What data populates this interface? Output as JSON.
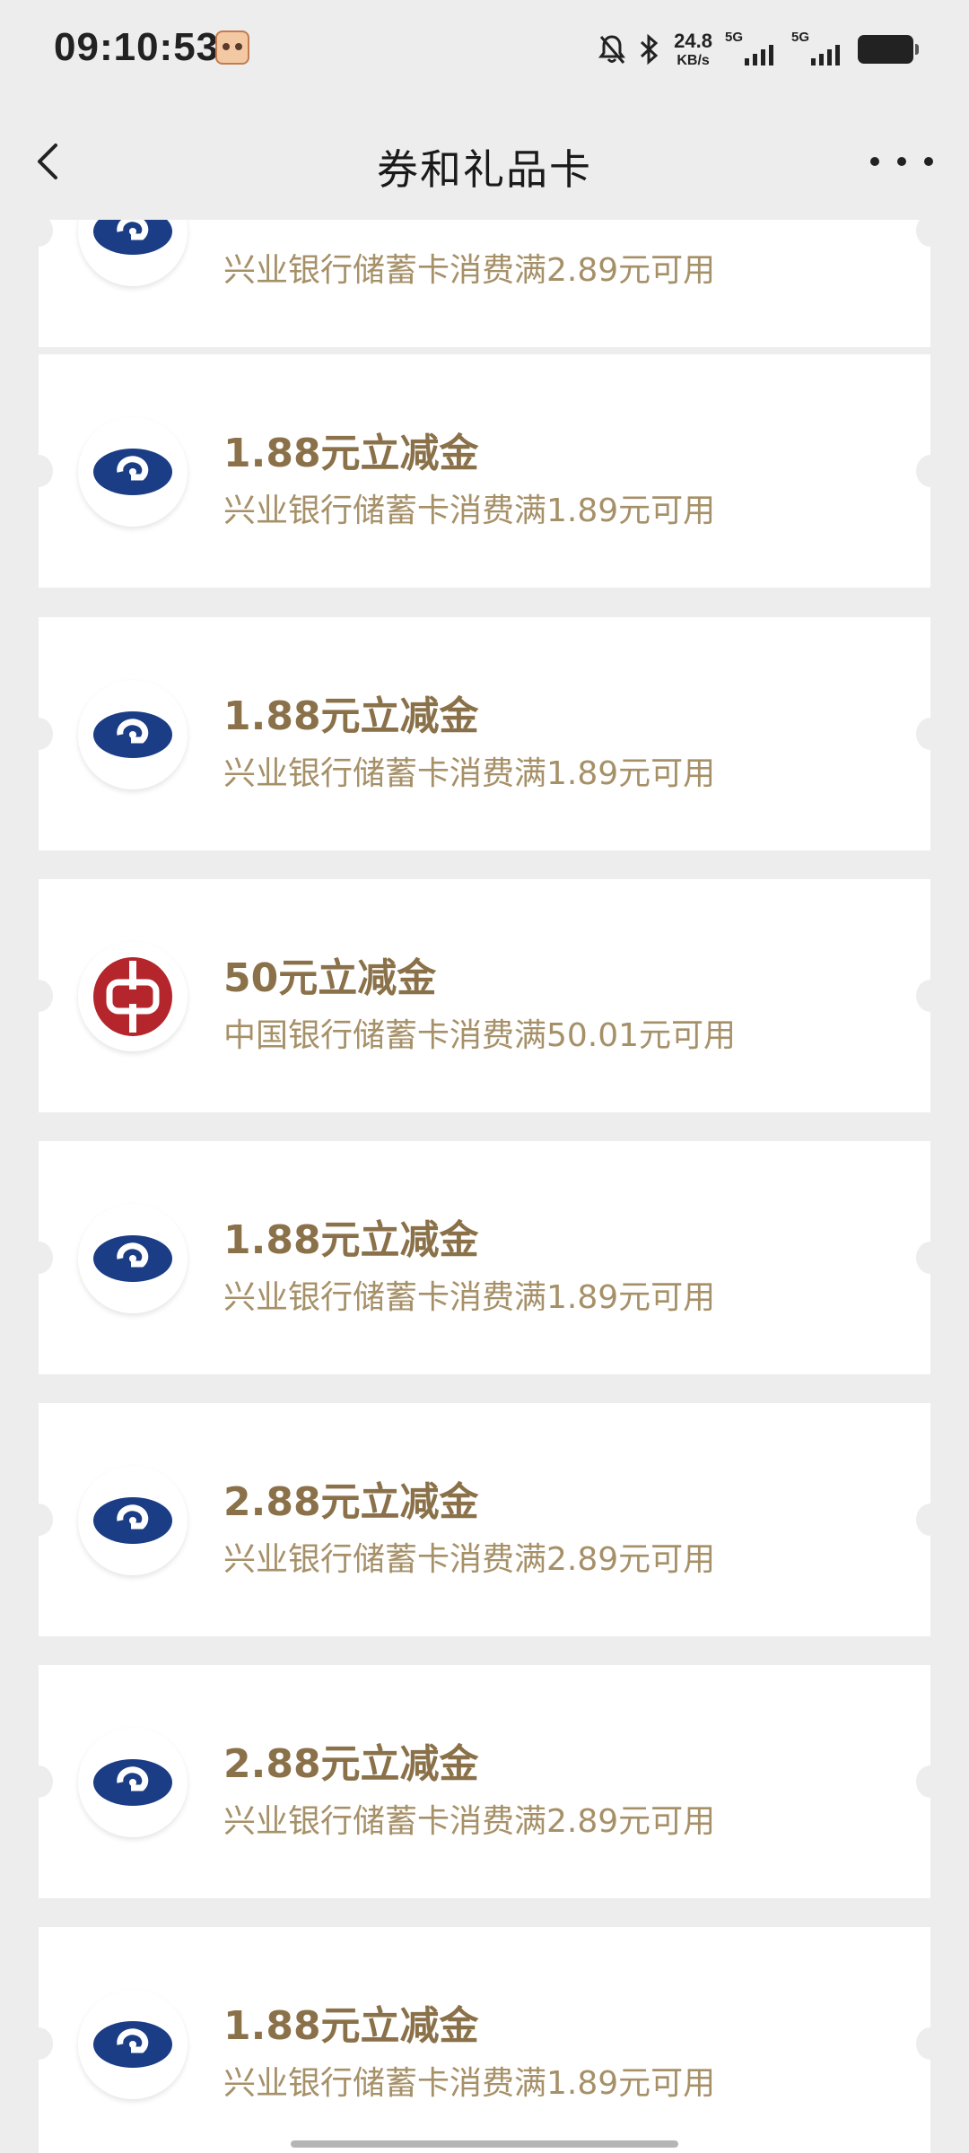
{
  "status": {
    "time": "09:10:53",
    "net_speed_value": "24.8",
    "net_speed_unit": "KB/s",
    "sim1_tag": "5G",
    "sim2_tag": "5G"
  },
  "header": {
    "title": "券和礼品卡"
  },
  "coupons": [
    {
      "bank": "cib",
      "title": "",
      "desc": "兴业银行储蓄卡消费满2.89元可用"
    },
    {
      "bank": "cib",
      "title": "1.88元立减金",
      "desc": "兴业银行储蓄卡消费满1.89元可用"
    },
    {
      "bank": "cib",
      "title": "1.88元立减金",
      "desc": "兴业银行储蓄卡消费满1.89元可用"
    },
    {
      "bank": "boc",
      "title": "50元立减金",
      "desc": "中国银行储蓄卡消费满50.01元可用"
    },
    {
      "bank": "cib",
      "title": "1.88元立减金",
      "desc": "兴业银行储蓄卡消费满1.89元可用"
    },
    {
      "bank": "cib",
      "title": "2.88元立减金",
      "desc": "兴业银行储蓄卡消费满2.89元可用"
    },
    {
      "bank": "cib",
      "title": "2.88元立减金",
      "desc": "兴业银行储蓄卡消费满2.89元可用"
    },
    {
      "bank": "cib",
      "title": "1.88元立减金",
      "desc": "兴业银行储蓄卡消费满1.89元可用"
    }
  ],
  "colors": {
    "background": "#ededed",
    "card": "#ffffff",
    "title_gold": "#8a7149",
    "desc_gold": "#a69068",
    "cib_blue": "#1b3d86",
    "boc_red": "#b4262b"
  }
}
